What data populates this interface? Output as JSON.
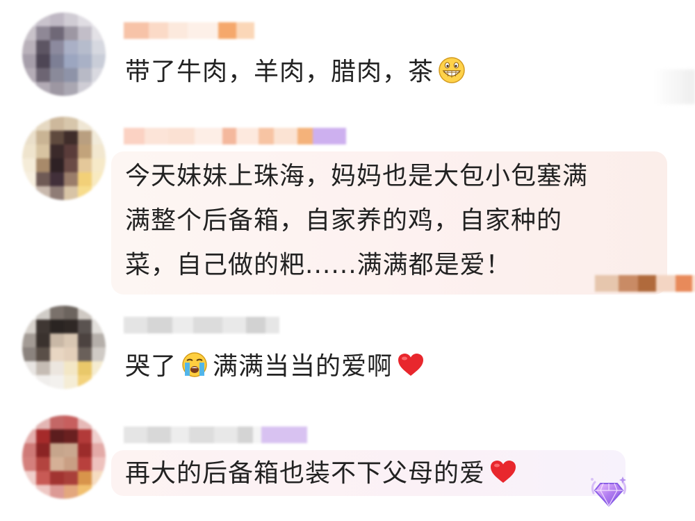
{
  "comments": [
    {
      "text": "带了牛肉，羊肉，腊肉，茶",
      "emoji": "grinning-face-icon"
    },
    {
      "lines": [
        "今天妹妹上珠海，妈妈也是大包小包塞满",
        "满整个后备箱，自家养的鸡，自家种的",
        "菜，自己做的粑......满满都是爱！"
      ]
    },
    {
      "text_before": "哭了",
      "emoji": "loudly-crying-face-icon",
      "text_after": "满满当当的爱啊",
      "trailing_icon": "red-heart-icon"
    },
    {
      "text": "再大的后备箱也装不下父母的爱",
      "trailing_icon": "red-heart-icon",
      "badge": "purple-diamond-badge-icon"
    }
  ],
  "colors": {
    "text": "#222222",
    "highlight_bubble_pink": "#fdf1f0",
    "highlight_bubble_lilac": "#f6f1fb",
    "heart": "#e8272d",
    "badge": "#a77ae8"
  }
}
